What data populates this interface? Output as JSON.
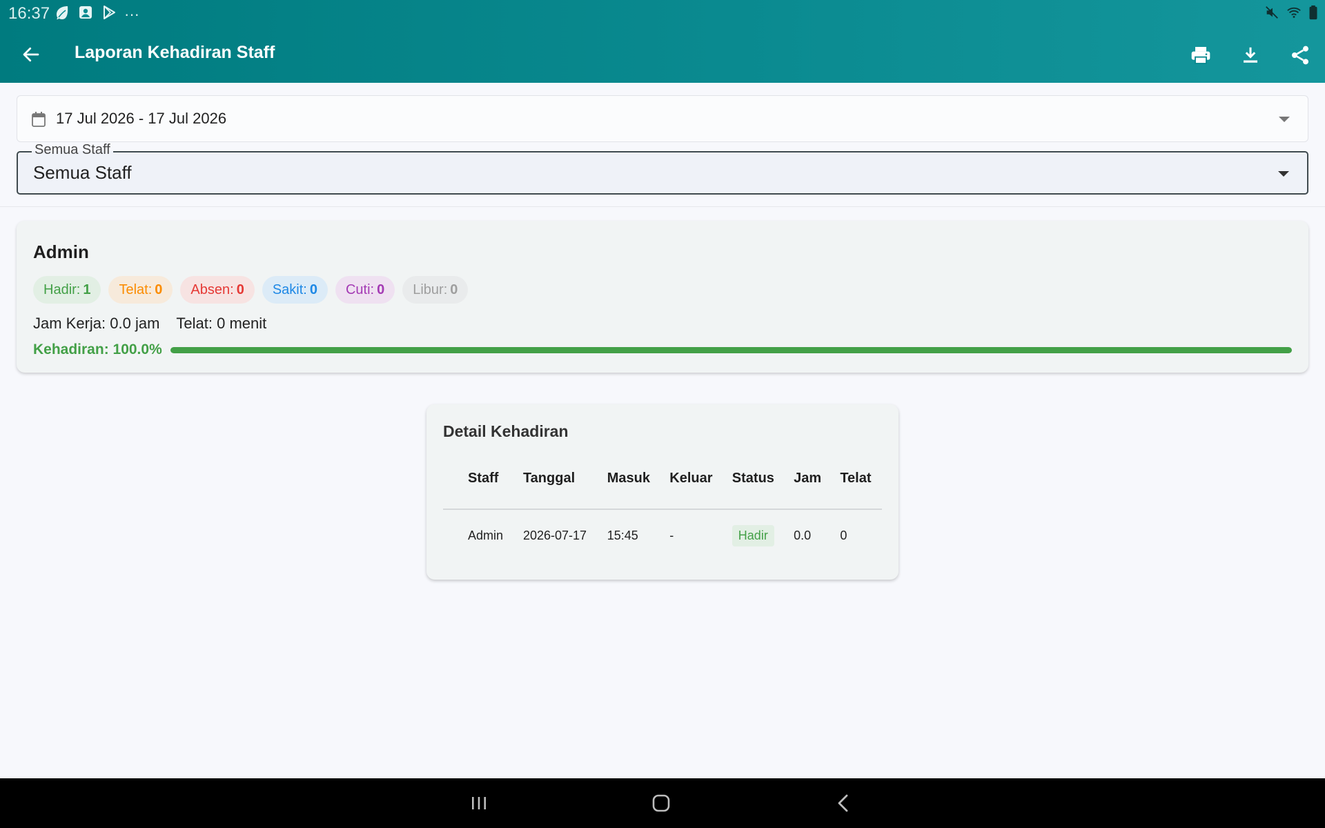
{
  "status_bar": {
    "time": "16:37",
    "left_icons": [
      "leaf-icon",
      "profile-square-icon",
      "play-store-icon",
      "more-dots-icon"
    ],
    "right_icons": [
      "mute-icon",
      "wifi-icon",
      "battery-icon"
    ],
    "more_glyph": "···"
  },
  "app_bar": {
    "title": "Laporan Kehadiran Staff",
    "actions": [
      "print-icon",
      "download-icon",
      "share-icon"
    ]
  },
  "filters": {
    "date_range": "17 Jul 2026 - 17 Jul 2026",
    "staff_label": "Semua Staff",
    "staff_value": "Semua Staff"
  },
  "summary": {
    "name": "Admin",
    "chips": [
      {
        "label": "Hadir:",
        "value": "1"
      },
      {
        "label": "Telat:",
        "value": "0"
      },
      {
        "label": "Absen:",
        "value": "0"
      },
      {
        "label": "Sakit:",
        "value": "0"
      },
      {
        "label": "Cuti:",
        "value": "0"
      },
      {
        "label": "Libur:",
        "value": "0"
      }
    ],
    "jam_kerja": "Jam Kerja: 0.0 jam",
    "telat": "Telat: 0 menit",
    "kehadiran_label": "Kehadiran: 100.0%",
    "kehadiran_percent": 100
  },
  "detail": {
    "title": "Detail Kehadiran",
    "columns": [
      "Staff",
      "Tanggal",
      "Masuk",
      "Keluar",
      "Status",
      "Jam",
      "Telat"
    ],
    "rows": [
      {
        "staff": "Admin",
        "tanggal": "2026-07-17",
        "masuk": "15:45",
        "keluar": "-",
        "status": "Hadir",
        "jam": "0.0",
        "telat": "0"
      }
    ]
  },
  "colors": {
    "app_bar": "#0a8a90",
    "hadir": "#43a047",
    "telat": "#fb8c00",
    "absen": "#e53935",
    "sakit": "#1e88e5",
    "cuti": "#a43ab4",
    "libur": "#9e9e9e"
  },
  "nav_bar": {
    "buttons": [
      "recents-icon",
      "home-icon",
      "back-nav-icon"
    ]
  }
}
